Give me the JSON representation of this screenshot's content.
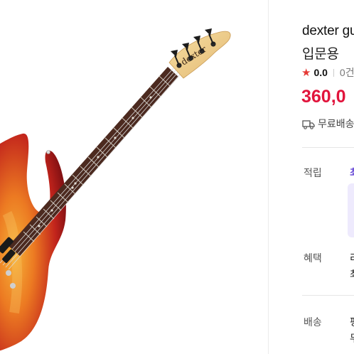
{
  "product": {
    "title_line1": "dexter gu",
    "title_line2": "입문용",
    "rating": "0.0",
    "reviews": "0건",
    "price": "360,0",
    "shipping": "무료배송"
  },
  "details": {
    "points_label": "적립",
    "points_value": "최",
    "benefits_label": "혜택",
    "benefits_value_1": "리",
    "benefits_value_2": "최",
    "delivery_label": "배송",
    "delivery_value_1": "평",
    "delivery_value_2": "무"
  },
  "image": {
    "brand_text": "dexter"
  },
  "colors": {
    "price": "#e1143c",
    "star": "#e53935",
    "accent": "#6a4cd6",
    "promo_bg": "#eeeafd"
  },
  "icons": [
    "star-icon",
    "truck-icon"
  ]
}
